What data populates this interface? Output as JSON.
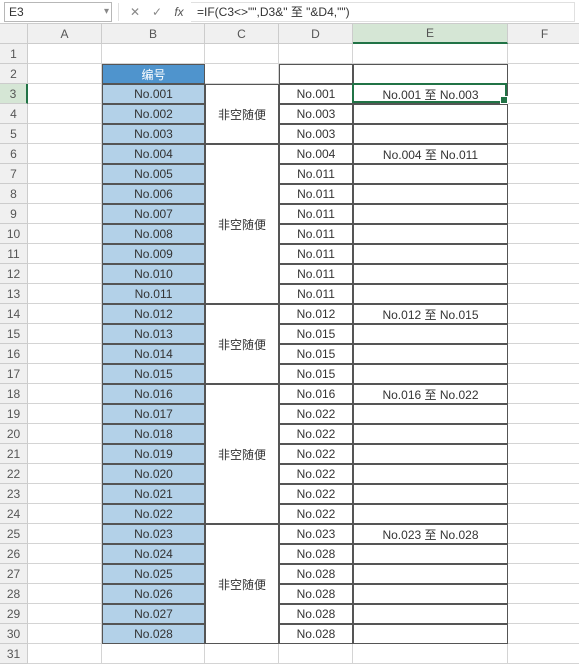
{
  "nameBox": "E3",
  "formula": "=IF(C3<>\"\",D3&\"  至  \"&D4,\"\")",
  "colWidths": {
    "A": 74,
    "B": 103,
    "C": 74,
    "D": 74,
    "E": 155,
    "F": 74
  },
  "columns": [
    "A",
    "B",
    "C",
    "D",
    "E",
    "F"
  ],
  "rowCount": 31,
  "activeCell": {
    "row": 3,
    "col": "E"
  },
  "header_B2": "编号",
  "chart_data": {
    "type": "table",
    "title": "",
    "columns": [
      "B",
      "C",
      "D",
      "E"
    ],
    "rows": [
      {
        "row": 2,
        "B": "编号",
        "C": "",
        "D": "",
        "E": ""
      },
      {
        "row": 3,
        "B": "No.001",
        "C": "非空随便",
        "D": "No.001",
        "E": "No.001  至  No.003"
      },
      {
        "row": 4,
        "B": "No.002",
        "C": "",
        "D": "No.003",
        "E": ""
      },
      {
        "row": 5,
        "B": "No.003",
        "C": "",
        "D": "No.003",
        "E": ""
      },
      {
        "row": 6,
        "B": "No.004",
        "C": "非空随便",
        "D": "No.004",
        "E": "No.004  至  No.011"
      },
      {
        "row": 7,
        "B": "No.005",
        "C": "",
        "D": "No.011",
        "E": ""
      },
      {
        "row": 8,
        "B": "No.006",
        "C": "",
        "D": "No.011",
        "E": ""
      },
      {
        "row": 9,
        "B": "No.007",
        "C": "",
        "D": "No.011",
        "E": ""
      },
      {
        "row": 10,
        "B": "No.008",
        "C": "",
        "D": "No.011",
        "E": ""
      },
      {
        "row": 11,
        "B": "No.009",
        "C": "",
        "D": "No.011",
        "E": ""
      },
      {
        "row": 12,
        "B": "No.010",
        "C": "",
        "D": "No.011",
        "E": ""
      },
      {
        "row": 13,
        "B": "No.011",
        "C": "",
        "D": "No.011",
        "E": ""
      },
      {
        "row": 14,
        "B": "No.012",
        "C": "非空随便",
        "D": "No.012",
        "E": "No.012  至  No.015"
      },
      {
        "row": 15,
        "B": "No.013",
        "C": "",
        "D": "No.015",
        "E": ""
      },
      {
        "row": 16,
        "B": "No.014",
        "C": "",
        "D": "No.015",
        "E": ""
      },
      {
        "row": 17,
        "B": "No.015",
        "C": "",
        "D": "No.015",
        "E": ""
      },
      {
        "row": 18,
        "B": "No.016",
        "C": "非空随便",
        "D": "No.016",
        "E": "No.016  至  No.022"
      },
      {
        "row": 19,
        "B": "No.017",
        "C": "",
        "D": "No.022",
        "E": ""
      },
      {
        "row": 20,
        "B": "No.018",
        "C": "",
        "D": "No.022",
        "E": ""
      },
      {
        "row": 21,
        "B": "No.019",
        "C": "",
        "D": "No.022",
        "E": ""
      },
      {
        "row": 22,
        "B": "No.020",
        "C": "",
        "D": "No.022",
        "E": ""
      },
      {
        "row": 23,
        "B": "No.021",
        "C": "",
        "D": "No.022",
        "E": ""
      },
      {
        "row": 24,
        "B": "No.022",
        "C": "",
        "D": "No.022",
        "E": ""
      },
      {
        "row": 25,
        "B": "No.023",
        "C": "非空随便",
        "D": "No.023",
        "E": "No.023  至  No.028"
      },
      {
        "row": 26,
        "B": "No.024",
        "C": "",
        "D": "No.028",
        "E": ""
      },
      {
        "row": 27,
        "B": "No.025",
        "C": "",
        "D": "No.028",
        "E": ""
      },
      {
        "row": 28,
        "B": "No.026",
        "C": "",
        "D": "No.028",
        "E": ""
      },
      {
        "row": 29,
        "B": "No.027",
        "C": "",
        "D": "No.028",
        "E": ""
      },
      {
        "row": 30,
        "B": "No.028",
        "C": "",
        "D": "No.028",
        "E": ""
      }
    ],
    "merges_C": [
      {
        "start": 3,
        "end": 5,
        "value": "非空随便"
      },
      {
        "start": 6,
        "end": 13,
        "value": "非空随便"
      },
      {
        "start": 14,
        "end": 17,
        "value": "非空随便"
      },
      {
        "start": 18,
        "end": 24,
        "value": "非空随便"
      },
      {
        "start": 25,
        "end": 30,
        "value": "非空随便"
      }
    ]
  }
}
